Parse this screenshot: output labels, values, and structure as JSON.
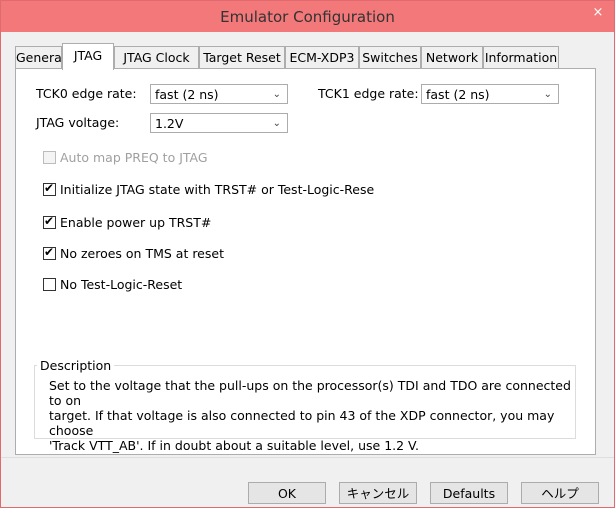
{
  "window": {
    "title": "Emulator Configuration",
    "close_glyph": "×"
  },
  "tabs": [
    {
      "label": "General"
    },
    {
      "label": "JTAG"
    },
    {
      "label": "JTAG Clock"
    },
    {
      "label": "Target Reset"
    },
    {
      "label": "ECM-XDP3"
    },
    {
      "label": "Switches"
    },
    {
      "label": "Network"
    },
    {
      "label": "Information"
    }
  ],
  "jtag": {
    "tck0_label": "TCK0 edge rate:",
    "tck0_value": "fast (2 ns)",
    "tck1_label": "TCK1 edge rate:",
    "tck1_value": "fast (2 ns)",
    "voltage_label": "JTAG voltage:",
    "voltage_value": "1.2V",
    "checkboxes": [
      {
        "label": "Auto map PREQ to JTAG",
        "checked": false,
        "disabled": true
      },
      {
        "label": "Initialize JTAG state with TRST# or Test-Logic-Rese",
        "checked": true,
        "disabled": false
      },
      {
        "label": "Enable power up TRST#",
        "checked": true,
        "disabled": false
      },
      {
        "label": "No zeroes on TMS at reset",
        "checked": true,
        "disabled": false
      },
      {
        "label": "No Test-Logic-Reset",
        "checked": false,
        "disabled": false
      }
    ]
  },
  "description": {
    "title": "Description",
    "lines": [
      "Set to the voltage that the pull-ups on the processor(s) TDI and TDO are connected to on",
      "target.  If that voltage is also connected to pin 43 of the XDP connector, you may choose",
      "'Track VTT_AB'. If in doubt about a suitable level, use 1.2 V."
    ]
  },
  "buttons": {
    "ok": "OK",
    "cancel": "キャンセル",
    "defaults": "Defaults",
    "help": "ヘルプ"
  },
  "check_glyph": "✔",
  "dropdown_glyph": "⌄",
  "icons": {
    "close": "close-icon",
    "dropdown": "chevron-down-icon",
    "check": "checkmark-icon"
  },
  "colors": {
    "titlebar": "#f3787a",
    "border": "#adadad"
  }
}
